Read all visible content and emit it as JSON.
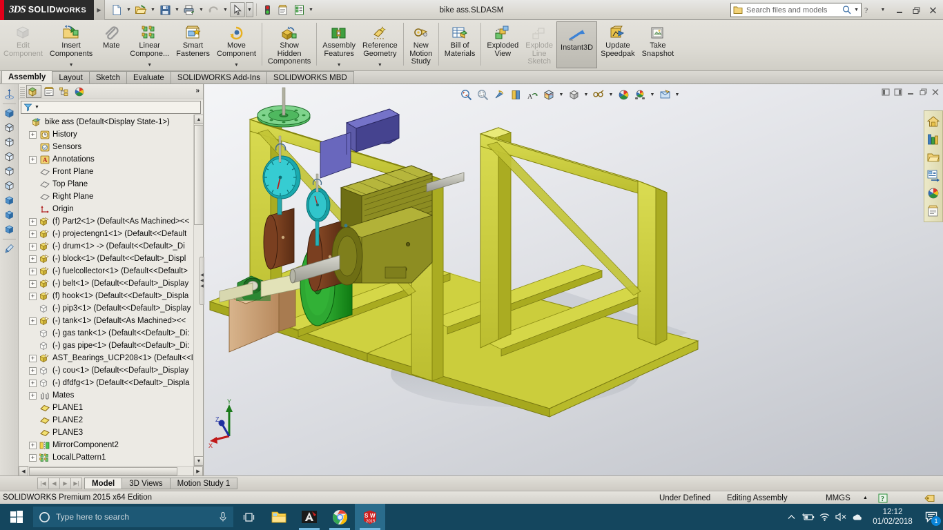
{
  "app": {
    "brand_ds": "3DS",
    "brand_name_upper": "SOLID",
    "brand_name_lower": "WORKS",
    "document_title": "bike ass.SLDASM"
  },
  "quick_access": {
    "items": [
      {
        "name": "new-document",
        "icon": "new-document-icon",
        "has_caret": true
      },
      {
        "name": "open-document",
        "icon": "open-folder-icon",
        "has_caret": true
      },
      {
        "name": "save-document",
        "icon": "save-disk-icon",
        "has_caret": true
      },
      {
        "name": "print-document",
        "icon": "printer-icon",
        "has_caret": true
      },
      {
        "name": "undo",
        "icon": "undo-arrow-icon",
        "has_caret": true
      },
      {
        "name": "select",
        "icon": "cursor-arrow-icon",
        "has_caret": true
      },
      {
        "name": "rebuild",
        "icon": "traffic-light-icon",
        "has_caret": false
      },
      {
        "name": "file-properties",
        "icon": "file-properties-icon",
        "has_caret": false
      },
      {
        "name": "options",
        "icon": "options-list-icon",
        "has_caret": true
      }
    ]
  },
  "search": {
    "placeholder": "Search files and models",
    "icon": "folder-search-icon",
    "magnifier": "magnifier-icon"
  },
  "window_controls": {
    "help": "?",
    "minimize": "–",
    "restore": "❐",
    "close": "✕"
  },
  "ribbon": {
    "commands": [
      {
        "label": "Edit\nComponent",
        "icon": "edit-component-icon",
        "disabled": true,
        "caret": false,
        "sep_after": false
      },
      {
        "label": "Insert\nComponents",
        "icon": "insert-components-icon",
        "disabled": false,
        "caret": true,
        "sep_after": false
      },
      {
        "label": "Mate",
        "icon": "mate-paperclip-icon",
        "disabled": false,
        "caret": false,
        "sep_after": false
      },
      {
        "label": "Linear\nCompone...",
        "icon": "linear-component-pattern-icon",
        "disabled": false,
        "caret": true,
        "sep_after": false
      },
      {
        "label": "Smart\nFasteners",
        "icon": "smart-fasteners-icon",
        "disabled": false,
        "caret": false,
        "sep_after": false
      },
      {
        "label": "Move\nComponent",
        "icon": "move-component-icon",
        "disabled": false,
        "caret": true,
        "sep_after": true
      },
      {
        "label": "Show\nHidden\nComponents",
        "icon": "show-hidden-components-icon",
        "disabled": false,
        "caret": false,
        "sep_after": true
      },
      {
        "label": "Assembly\nFeatures",
        "icon": "assembly-features-icon",
        "disabled": false,
        "caret": true,
        "sep_after": false
      },
      {
        "label": "Reference\nGeometry",
        "icon": "reference-geometry-icon",
        "disabled": false,
        "caret": true,
        "sep_after": true
      },
      {
        "label": "New\nMotion\nStudy",
        "icon": "new-motion-study-icon",
        "disabled": false,
        "caret": false,
        "sep_after": true
      },
      {
        "label": "Bill of\nMaterials",
        "icon": "bill-of-materials-icon",
        "disabled": false,
        "caret": false,
        "sep_after": true
      },
      {
        "label": "Exploded\nView",
        "icon": "exploded-view-icon",
        "disabled": false,
        "caret": false,
        "sep_after": false
      },
      {
        "label": "Explode\nLine\nSketch",
        "icon": "explode-line-sketch-icon",
        "disabled": true,
        "caret": false,
        "sep_after": false
      },
      {
        "label": "Instant3D",
        "icon": "instant3d-icon",
        "disabled": false,
        "caret": false,
        "active": true,
        "sep_after": false
      },
      {
        "label": "Update\nSpeedpak",
        "icon": "update-speedpak-icon",
        "disabled": false,
        "caret": false,
        "sep_after": false
      },
      {
        "label": "Take\nSnapshot",
        "icon": "take-snapshot-icon",
        "disabled": false,
        "caret": false,
        "sep_after": false
      }
    ]
  },
  "tabs": [
    {
      "label": "Assembly",
      "active": true
    },
    {
      "label": "Layout",
      "active": false
    },
    {
      "label": "Sketch",
      "active": false
    },
    {
      "label": "Evaluate",
      "active": false
    },
    {
      "label": "SOLIDWORKS Add-Ins",
      "active": false
    },
    {
      "label": "SOLIDWORKS MBD",
      "active": false
    }
  ],
  "icon_rail": {
    "items": [
      {
        "name": "rail-origin-triad",
        "icon": "origin-triad-icon"
      },
      {
        "name": "rail-view-1",
        "icon": "view-cube-solid-icon"
      },
      {
        "name": "rail-view-2",
        "icon": "view-cube-wire-icon"
      },
      {
        "name": "rail-view-3",
        "icon": "view-cube-wire-icon"
      },
      {
        "name": "rail-view-4",
        "icon": "view-cube-wire-icon"
      },
      {
        "name": "rail-view-5",
        "icon": "view-cube-wire-icon"
      },
      {
        "name": "rail-view-6",
        "icon": "view-cube-wire-icon"
      },
      {
        "name": "rail-view-7",
        "icon": "view-cube-blue-icon"
      },
      {
        "name": "rail-view-8",
        "icon": "view-cube-blue-icon"
      },
      {
        "name": "rail-view-9",
        "icon": "view-cube-blue-icon"
      },
      {
        "name": "rail-appearance",
        "icon": "appearance-brush-icon"
      }
    ]
  },
  "feature_manager": {
    "tabs": [
      {
        "name": "feature-manager-tab",
        "icon": "feature-tree-icon",
        "selected": true
      },
      {
        "name": "property-manager-tab",
        "icon": "property-manager-icon",
        "selected": false
      },
      {
        "name": "configuration-manager-tab",
        "icon": "configuration-manager-icon",
        "selected": false
      },
      {
        "name": "display-manager-tab",
        "icon": "display-manager-icon",
        "selected": false
      }
    ],
    "overflow": "»",
    "filter_icon": "filter-funnel-icon",
    "filter_placeholder": "",
    "tree": [
      {
        "label": "bike ass  (Default<Display State-1>)",
        "icon": "assembly-icon",
        "expander": "none",
        "indent": 0
      },
      {
        "label": "History",
        "icon": "history-clock-icon",
        "expander": "+",
        "indent": 1
      },
      {
        "label": "Sensors",
        "icon": "sensors-icon",
        "expander": "none",
        "indent": 1
      },
      {
        "label": "Annotations",
        "icon": "annotations-a-icon",
        "expander": "+",
        "indent": 1
      },
      {
        "label": "Front Plane",
        "icon": "plane-icon",
        "expander": "none",
        "indent": 1
      },
      {
        "label": "Top Plane",
        "icon": "plane-icon",
        "expander": "none",
        "indent": 1
      },
      {
        "label": "Right Plane",
        "icon": "plane-icon",
        "expander": "none",
        "indent": 1
      },
      {
        "label": "Origin",
        "icon": "origin-icon",
        "expander": "none",
        "indent": 1
      },
      {
        "label": "(f) Part2<1>  (Default<As Machined><<",
        "icon": "component-icon",
        "expander": "+",
        "indent": 1
      },
      {
        "label": "(-) projectengn1<1>  (Default<<Default",
        "icon": "component-icon",
        "expander": "+",
        "indent": 1
      },
      {
        "label": "(-) drum<1> ->  (Default<<Default>_Di",
        "icon": "component-icon",
        "expander": "+",
        "indent": 1
      },
      {
        "label": "(-) block<1>  (Default<<Default>_Displ",
        "icon": "component-icon",
        "expander": "+",
        "indent": 1
      },
      {
        "label": "(-) fuelcollector<1>  (Default<<Default>",
        "icon": "component-icon",
        "expander": "+",
        "indent": 1
      },
      {
        "label": "(-) belt<1>  (Default<<Default>_Display",
        "icon": "component-icon",
        "expander": "+",
        "indent": 1
      },
      {
        "label": "(f) hook<1>  (Default<<Default>_Displa",
        "icon": "component-icon",
        "expander": "+",
        "indent": 1
      },
      {
        "label": "(-) pip3<1>  (Default<<Default>_Display",
        "icon": "component-hidden-icon",
        "expander": "none",
        "indent": 1
      },
      {
        "label": "(-) tank<1>  (Default<As Machined><<",
        "icon": "component-icon",
        "expander": "+",
        "indent": 1
      },
      {
        "label": "(-) gas tank<1>  (Default<<Default>_Di:",
        "icon": "component-hidden-icon",
        "expander": "none",
        "indent": 1
      },
      {
        "label": "(-) gas pipe<1>  (Default<<Default>_Di:",
        "icon": "component-hidden-icon",
        "expander": "none",
        "indent": 1
      },
      {
        "label": "AST_Bearings_UCP208<1>  (Default<<D",
        "icon": "component-icon",
        "expander": "+",
        "indent": 1
      },
      {
        "label": "(-) cou<1>  (Default<<Default>_Display",
        "icon": "component-hidden-icon",
        "expander": "+",
        "indent": 1
      },
      {
        "label": "(-) dfdfg<1>  (Default<<Default>_Displa",
        "icon": "component-hidden-icon",
        "expander": "+",
        "indent": 1
      },
      {
        "label": "Mates",
        "icon": "mates-icon",
        "expander": "+",
        "indent": 1
      },
      {
        "label": "PLANE1",
        "icon": "plane-yellow-icon",
        "expander": "none",
        "indent": 1
      },
      {
        "label": "PLANE2",
        "icon": "plane-yellow-icon",
        "expander": "none",
        "indent": 1
      },
      {
        "label": "PLANE3",
        "icon": "plane-yellow-icon",
        "expander": "none",
        "indent": 1
      },
      {
        "label": "MirrorComponent2",
        "icon": "mirror-component-icon",
        "expander": "+",
        "indent": 1
      },
      {
        "label": "LocalLPattern1",
        "icon": "local-pattern-icon",
        "expander": "+",
        "indent": 1
      }
    ]
  },
  "heads_up_toolbar": {
    "items": [
      {
        "name": "zoom-to-fit",
        "icon": "zoom-to-fit-icon",
        "caret": false
      },
      {
        "name": "zoom-to-area",
        "icon": "zoom-to-area-icon",
        "caret": false
      },
      {
        "name": "previous-view",
        "icon": "previous-view-icon",
        "caret": false
      },
      {
        "name": "section-view",
        "icon": "section-view-icon",
        "caret": false
      },
      {
        "name": "view-orientation",
        "icon": "view-orientation-icon",
        "caret": false
      },
      {
        "name": "display-style",
        "icon": "display-style-icon",
        "caret": true
      },
      {
        "name": "hide-show-items",
        "icon": "hide-show-items-icon",
        "caret": true
      },
      {
        "name": "edit-appearance",
        "icon": "edit-appearance-icon",
        "caret": true
      },
      {
        "name": "apply-scene",
        "icon": "apply-scene-icon",
        "caret": false
      },
      {
        "name": "view-settings",
        "icon": "view-settings-icon",
        "caret": true
      },
      {
        "name": "display-pane",
        "icon": "display-pane-icon",
        "caret": true
      }
    ]
  },
  "graphics_window_controls": {
    "collapse_left": "◨",
    "collapse_right": "◧",
    "minimize": "–",
    "restore": "❐",
    "close": "✕"
  },
  "task_pane": {
    "items": [
      {
        "name": "solidworks-resources",
        "icon": "home-house-icon"
      },
      {
        "name": "design-library",
        "icon": "design-library-icon"
      },
      {
        "name": "file-explorer",
        "icon": "folder-icon"
      },
      {
        "name": "view-palette",
        "icon": "view-palette-icon"
      },
      {
        "name": "appearances-scenes",
        "icon": "appearances-sphere-icon"
      },
      {
        "name": "custom-properties",
        "icon": "custom-properties-icon"
      }
    ]
  },
  "triad": {
    "x_label": "X",
    "y_label": "Y",
    "z_label": "Z"
  },
  "bottom_tabs": {
    "nav": [
      {
        "name": "first-tab-button",
        "glyph": "|◀"
      },
      {
        "name": "previous-tab-button",
        "glyph": "◀"
      },
      {
        "name": "next-tab-button",
        "glyph": "▶"
      },
      {
        "name": "last-tab-button",
        "glyph": "▶|"
      }
    ],
    "tabs": [
      {
        "label": "Model",
        "active": true
      },
      {
        "label": "3D Views",
        "active": false
      },
      {
        "label": "Motion Study 1",
        "active": false
      }
    ]
  },
  "status_bar": {
    "edition": "SOLIDWORKS Premium 2015 x64 Edition",
    "state": "Under Defined",
    "mode": "Editing Assembly",
    "units": "MMGS",
    "units_caret": "▲",
    "help_icon": "help-question-icon",
    "tag_icon": "tag-icon"
  },
  "taskbar": {
    "start_icon": "windows-start-icon",
    "cortana_icon": "cortana-circle-icon",
    "search_placeholder": "Type here to search",
    "mic_icon": "microphone-icon",
    "task_view_icon": "task-view-icon",
    "apps": [
      {
        "name": "file-explorer-taskbar",
        "icon": "file-explorer-icon",
        "open": false,
        "active": false
      },
      {
        "name": "autocad-taskbar",
        "icon": "autocad-icon",
        "open": true,
        "active": false
      },
      {
        "name": "chrome-taskbar",
        "icon": "chrome-icon",
        "open": true,
        "active": false
      },
      {
        "name": "solidworks-taskbar",
        "icon": "solidworks-icon",
        "open": true,
        "active": true,
        "badge": "2015"
      }
    ],
    "tray": [
      {
        "name": "show-hidden-icons",
        "glyph": "⌃"
      },
      {
        "name": "battery-icon",
        "glyph": "battery"
      },
      {
        "name": "wifi-icon",
        "glyph": "wifi"
      },
      {
        "name": "volume-muted-icon",
        "glyph": "mute"
      },
      {
        "name": "onedrive-icon",
        "glyph": "cloud"
      }
    ],
    "clock_time": "12:12",
    "clock_date": "01/02/2018",
    "action_center_badge": "1"
  },
  "colors": {
    "brand_red": "#e2001a",
    "frame_yellow": "#cfcf33",
    "drum_green": "#21a021",
    "gauge_teal": "#24bcbc",
    "motor_olive": "#8a8a1e",
    "tank_purple": "#514f9e",
    "block_brown": "#6e3a1e",
    "base_tan": "#c9a178",
    "taskbar_blue": "#14465e",
    "accent_blue": "#0a84d8"
  }
}
